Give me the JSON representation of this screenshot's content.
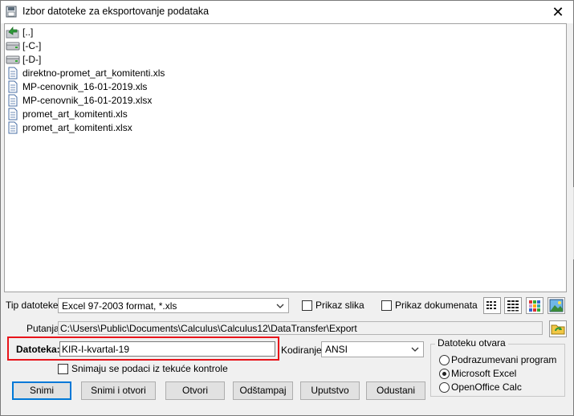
{
  "window": {
    "title": "Izbor datoteke za eksportovanje podataka",
    "close_glyph": "✕"
  },
  "file_list": {
    "items": [
      {
        "label": "[..]",
        "icon": "folder-up-icon"
      },
      {
        "label": "[-C-]",
        "icon": "drive-icon"
      },
      {
        "label": "[-D-]",
        "icon": "drive-icon"
      },
      {
        "label": "direktno-promet_art_komitenti.xls",
        "icon": "document-icon"
      },
      {
        "label": "MP-cenovnik_16-01-2019.xls",
        "icon": "document-icon"
      },
      {
        "label": "MP-cenovnik_16-01-2019.xlsx",
        "icon": "document-icon"
      },
      {
        "label": "promet_art_komitenti.xls",
        "icon": "document-icon"
      },
      {
        "label": "promet_art_komitenti.xlsx",
        "icon": "document-icon"
      }
    ]
  },
  "file_type": {
    "label": "Tip datoteke:",
    "value": "Excel 97-2003 format, *.xls"
  },
  "options": {
    "show_images": "Prikaz slika",
    "show_documents": "Prikaz dokumenata",
    "save_from_control": "Snimaju se podaci iz tekuće kontrole"
  },
  "view_buttons": [
    "list-view-icon",
    "detail-view-icon",
    "thumbnail-view-icon",
    "image-view-icon"
  ],
  "path": {
    "label": "Putanja:",
    "value": "C:\\Users\\Public\\Documents\\Calculus\\Calculus12\\DataTransfer\\Export"
  },
  "file_name": {
    "label": "Datoteka:",
    "value": "KIR-I-kvartal-19"
  },
  "encoding": {
    "label": "Kodiranje:",
    "value": "ANSI"
  },
  "open_with": {
    "title": "Datoteku otvara",
    "options": [
      {
        "label": "Podrazumevani program",
        "checked": false
      },
      {
        "label": "Microsoft Excel",
        "checked": true
      },
      {
        "label": "OpenOffice Calc",
        "checked": false
      }
    ]
  },
  "buttons": {
    "save": "Snimi",
    "save_open": "Snimi i otvori",
    "open": "Otvori",
    "print": "Odštampaj",
    "help": "Uputstvo",
    "cancel": "Odustani"
  },
  "colors": {
    "highlight": "#e8141a",
    "default_button_border": "#0078d7"
  }
}
